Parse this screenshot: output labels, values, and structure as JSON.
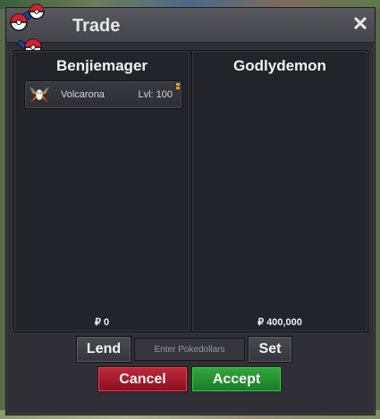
{
  "window": {
    "title": "Trade",
    "close_label": "✕"
  },
  "left": {
    "trainer": "Benjiemager",
    "money": "₽ 0",
    "pokemon": [
      {
        "name": "Volcarona",
        "level": "Lvl: 100"
      }
    ]
  },
  "right": {
    "trainer": "Godlydemon",
    "money": "₽ 400,000"
  },
  "controls": {
    "lend_label": "Lend",
    "amount_placeholder": "Enter Pokedollars",
    "set_label": "Set",
    "cancel_label": "Cancel",
    "accept_label": "Accept"
  },
  "colors": {
    "cancel": "#a81c2e",
    "accept": "#28943a",
    "panel": "#23232a"
  },
  "icons": [
    "pokeball-logo-icon",
    "close-icon",
    "volcarona-sprite-icon",
    "item-flag-icon"
  ]
}
